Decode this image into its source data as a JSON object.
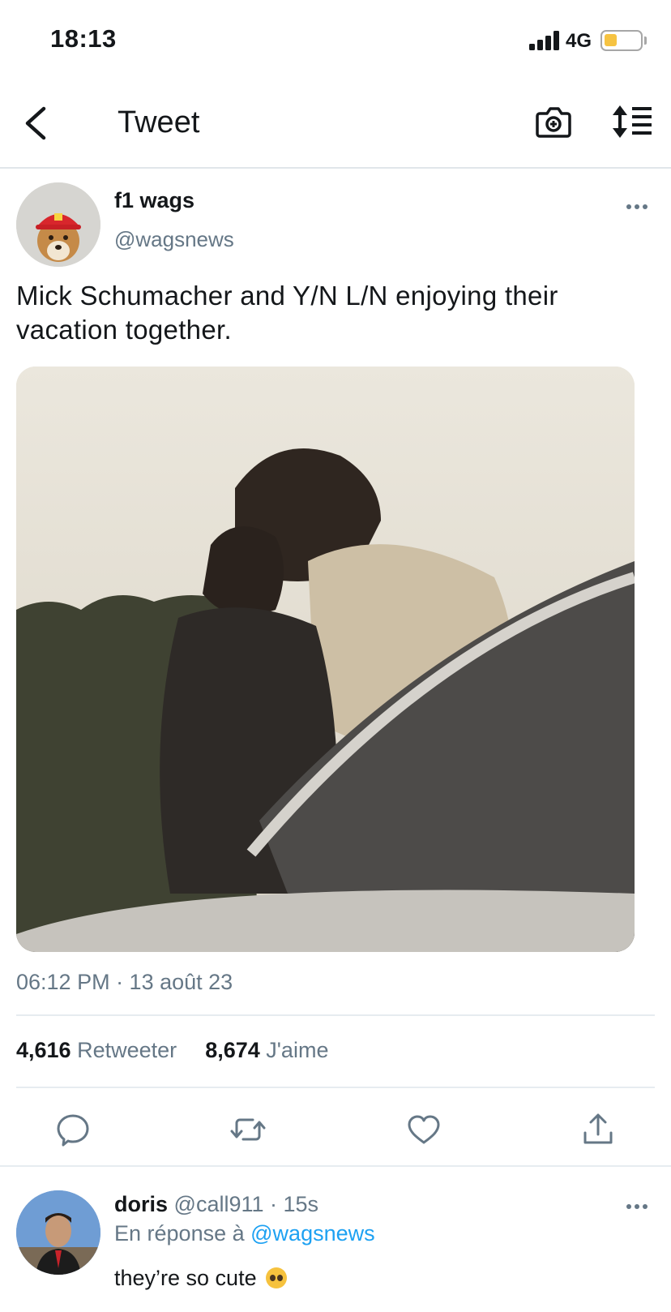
{
  "status_bar": {
    "time": "18:13",
    "network": "4G",
    "battery_level": 0.35,
    "battery_color": "#f6c342"
  },
  "nav": {
    "title": "Tweet",
    "back_icon": "chevron-left-icon",
    "camera_icon": "camera-add-icon",
    "sort_icon": "sort-icon"
  },
  "tweet": {
    "author_name": "f1 wags",
    "author_handle": "@wagsnews",
    "text": "Mick Schumacher and Y/N L/N enjoying their vacation together.",
    "timestamp": "06:12 PM · 13 août 23",
    "retweets_count": "4,616",
    "retweets_label": "Retweeter",
    "likes_count": "8,674",
    "likes_label": "J'aime",
    "photo": "couple-kissing-photo"
  },
  "actions": [
    "reply-icon",
    "retweet-icon",
    "like-icon",
    "share-icon"
  ],
  "reply": {
    "name": "doris",
    "handle": "@call911",
    "time": "· 15s",
    "reply_prefix": "En réponse à",
    "reply_to": "@wagsnews",
    "text": "they’re so cute"
  },
  "colors": {
    "text": "#14171a",
    "secondary": "#657786",
    "link": "#1da1f2",
    "divider": "#e6ecf0"
  }
}
